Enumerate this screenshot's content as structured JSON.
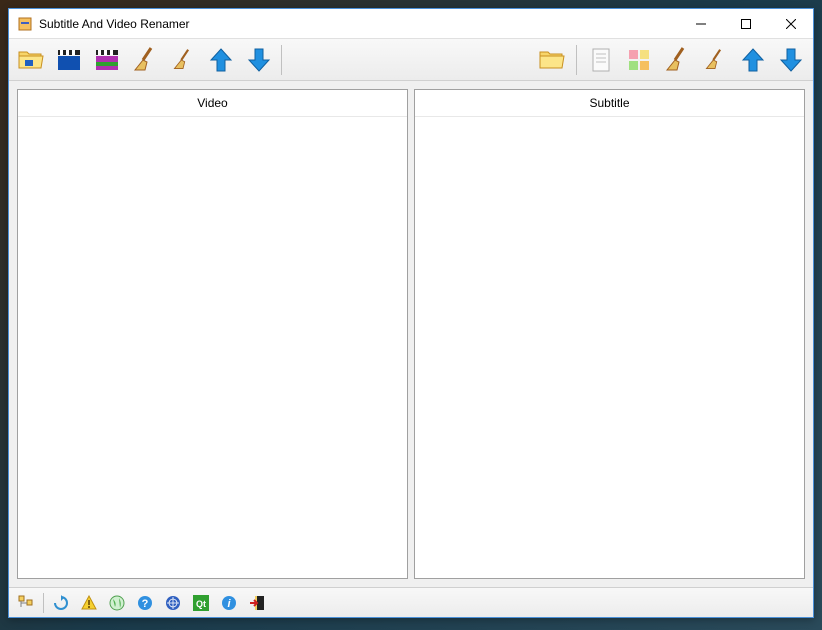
{
  "window": {
    "title": "Subtitle And Video Renamer"
  },
  "toolbar_left": {
    "icons": [
      "folder-video",
      "clapper-blue",
      "clapper-color",
      "broom-large",
      "broom-small",
      "arrow-up",
      "arrow-down"
    ]
  },
  "toolbar_right": {
    "icons": [
      "folder-subtitle",
      "document",
      "color-grid",
      "broom-large",
      "broom-small",
      "arrow-up",
      "arrow-down"
    ]
  },
  "panels": {
    "left": {
      "header": "Video"
    },
    "right": {
      "header": "Subtitle"
    }
  },
  "statusbar": {
    "icons": [
      "tree",
      "refresh",
      "warning",
      "globe",
      "help",
      "un-globe",
      "qt",
      "info",
      "exit"
    ]
  }
}
